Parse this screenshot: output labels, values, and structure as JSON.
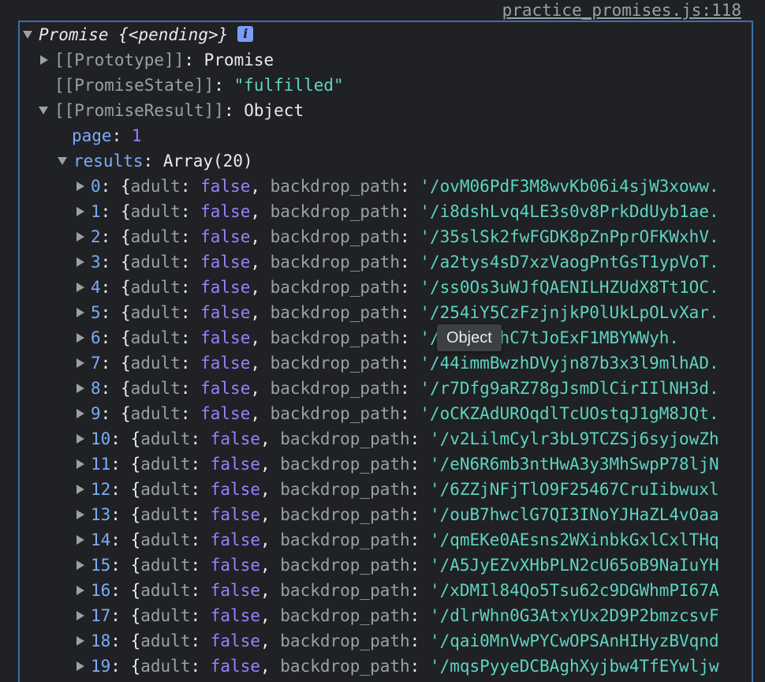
{
  "source_link": "practice_promises.js:118",
  "promise": {
    "label": "Promise",
    "state_summary": "{<pending>}",
    "info_icon": "i"
  },
  "prototype": {
    "key": "[[Prototype]]",
    "value": "Promise"
  },
  "promise_state": {
    "key": "[[PromiseState]]",
    "value": "\"fulfilled\""
  },
  "promise_result": {
    "key": "[[PromiseResult]]",
    "value": "Object"
  },
  "page": {
    "key": "page",
    "value": "1"
  },
  "results": {
    "key": "results",
    "value": "Array(20)"
  },
  "rows": [
    {
      "index": "0",
      "adult": "false",
      "backdrop_path": "'/ovM06PdF3M8wvKb06i4sjW3xoww."
    },
    {
      "index": "1",
      "adult": "false",
      "backdrop_path": "'/i8dshLvq4LE3s0v8PrkDdUyb1ae."
    },
    {
      "index": "2",
      "adult": "false",
      "backdrop_path": "'/35slSk2fwFGDK8pZnPprOFKWxhV."
    },
    {
      "index": "3",
      "adult": "false",
      "backdrop_path": "'/a2tys4sD7xzVaogPntGsT1ypVoT."
    },
    {
      "index": "4",
      "adult": "false",
      "backdrop_path": "'/ss0Os3uWJfQAENILHZUdX8Tt1OC."
    },
    {
      "index": "5",
      "adult": "false",
      "backdrop_path": "'/254iY5CzFzjnjkP0lUkLpOLvXar."
    },
    {
      "index": "6",
      "adult": "false",
      "backdrop_path": "'/     0b7dNhC7tJoExF1MBYWWyh."
    },
    {
      "index": "7",
      "adult": "false",
      "backdrop_path": "'/44immBwzhDVyjn87b3x3l9mlhAD."
    },
    {
      "index": "8",
      "adult": "false",
      "backdrop_path": "'/r7Dfg9aRZ78gJsmDlCirIIlNH3d."
    },
    {
      "index": "9",
      "adult": "false",
      "backdrop_path": "'/oCKZAdUROqdlTcUOstqJ1gM8JQt."
    },
    {
      "index": "10",
      "adult": "false",
      "backdrop_path": "'/v2LilmCylr3bL9TCZSj6syjowZh"
    },
    {
      "index": "11",
      "adult": "false",
      "backdrop_path": "'/eN6R6mb3ntHwA3y3MhSwpP78ljN"
    },
    {
      "index": "12",
      "adult": "false",
      "backdrop_path": "'/6ZZjNFjTlO9F25467CruIibwuxl"
    },
    {
      "index": "13",
      "adult": "false",
      "backdrop_path": "'/ouB7hwclG7QI3INoYJHaZL4vOaa"
    },
    {
      "index": "14",
      "adult": "false",
      "backdrop_path": "'/qmEKe0AEsns2WXinbkGxlCxlTHq"
    },
    {
      "index": "15",
      "adult": "false",
      "backdrop_path": "'/A5JyEZvXHbPLN2cU65oB9NaIuYH"
    },
    {
      "index": "16",
      "adult": "false",
      "backdrop_path": "'/xDMIl84Qo5Tsu62c9DGWhmPI67A"
    },
    {
      "index": "17",
      "adult": "false",
      "backdrop_path": "'/dlrWhn0G3AtxYUx2D9P2bmzcsvF"
    },
    {
      "index": "18",
      "adult": "false",
      "backdrop_path": "'/qai0MnVwPYCwOPSAnHIHyzBVqnd"
    },
    {
      "index": "19",
      "adult": "false",
      "backdrop_path": "'/mqsPyyeDCBAghXyjbw4TfEYwljw"
    }
  ],
  "row_labels": {
    "open_brace": "{",
    "adult_key": "adult",
    "backdrop_key": "backdrop_path"
  },
  "tooltip": {
    "text": "Object"
  },
  "colors": {
    "background": "#202124",
    "selection_border": "#3d6ea8",
    "string": "#5cd5c1",
    "number": "#9980ff",
    "key": "#7cacf8",
    "internal_key": "#9aa0a6",
    "info_badge": "#7c9cf5"
  },
  "icons": {
    "expanded": "triangle-down-icon",
    "collapsed": "triangle-right-icon",
    "info": "info-icon"
  }
}
